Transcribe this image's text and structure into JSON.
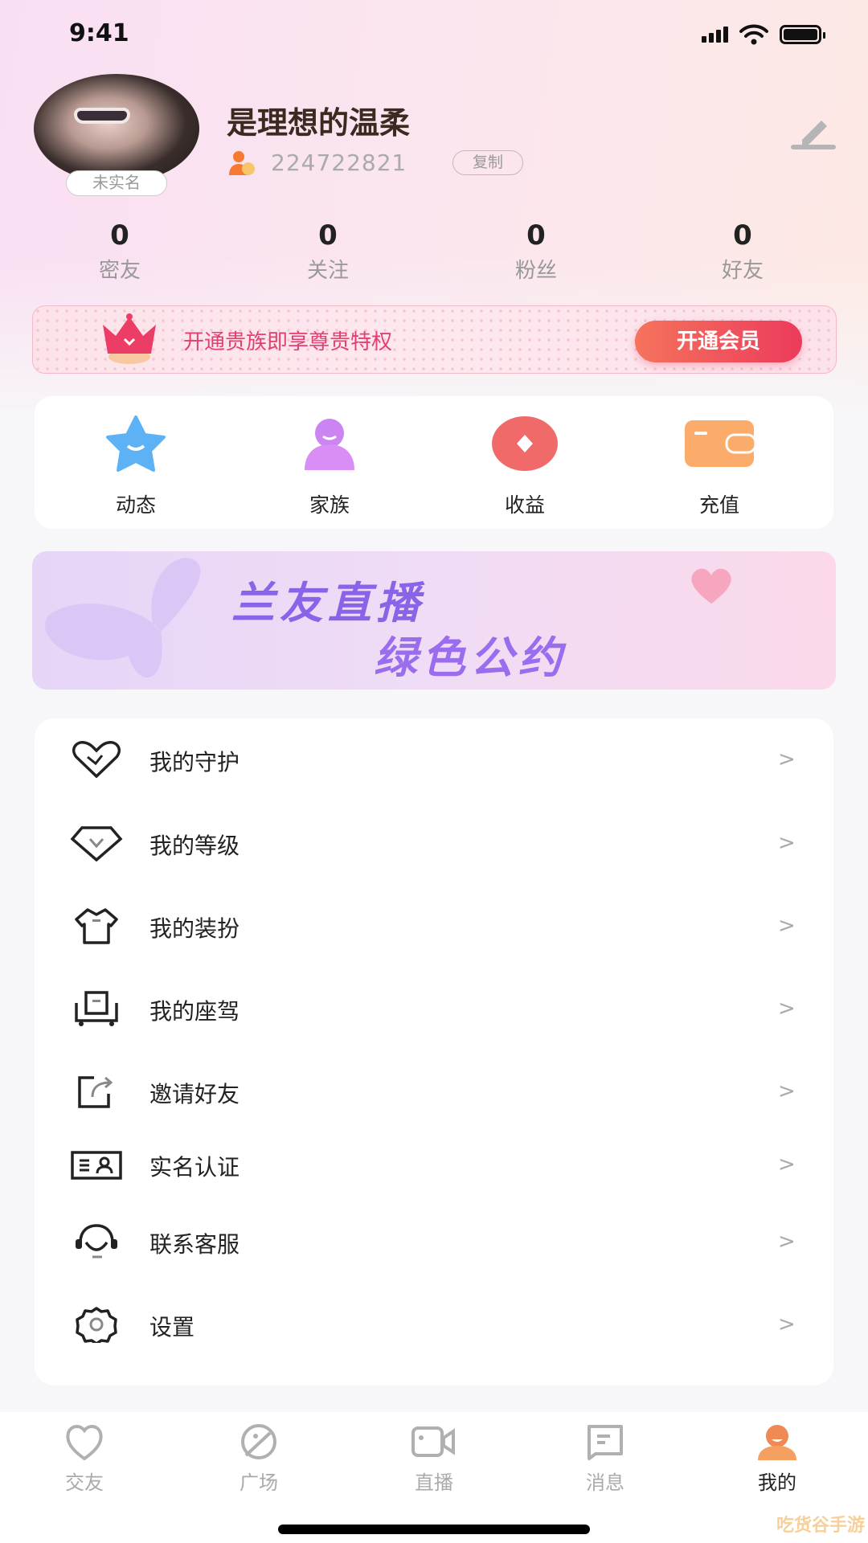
{
  "status_bar": {
    "time": "9:41"
  },
  "profile": {
    "name": "是理想的温柔",
    "user_id": "224722821",
    "copy_label": "复制",
    "verify_badge": "未实名"
  },
  "stats": [
    {
      "value": "0",
      "label": "密友"
    },
    {
      "value": "0",
      "label": "关注"
    },
    {
      "value": "0",
      "label": "粉丝"
    },
    {
      "value": "0",
      "label": "好友"
    }
  ],
  "vip_banner": {
    "text": "开通贵族即享尊贵特权",
    "button": "开通会员"
  },
  "quick_actions": [
    {
      "label": "动态",
      "icon": "star-icon"
    },
    {
      "label": "家族",
      "icon": "family-icon"
    },
    {
      "label": "收益",
      "icon": "coin-icon"
    },
    {
      "label": "充值",
      "icon": "wallet-icon"
    }
  ],
  "promo_banner": {
    "line1": "兰友直播",
    "line2": "绿色公约"
  },
  "menu": [
    {
      "label": "我的守护",
      "icon": "guard-heart-icon"
    },
    {
      "label": "我的等级",
      "icon": "diamond-icon"
    },
    {
      "label": "我的装扮",
      "icon": "shirt-icon"
    },
    {
      "label": "我的座驾",
      "icon": "car-icon"
    },
    {
      "label": "邀请好友",
      "icon": "share-icon"
    },
    {
      "label": "实名认证",
      "icon": "id-card-icon"
    },
    {
      "label": "联系客服",
      "icon": "headset-icon"
    },
    {
      "label": "设置",
      "icon": "gear-icon"
    }
  ],
  "chevron": ">",
  "tabs": [
    {
      "label": "交友",
      "icon": "heart-icon"
    },
    {
      "label": "广场",
      "icon": "planet-icon"
    },
    {
      "label": "直播",
      "icon": "video-camera-icon"
    },
    {
      "label": "消息",
      "icon": "message-icon"
    },
    {
      "label": "我的",
      "icon": "user-icon",
      "active": true
    }
  ],
  "colors": {
    "accent": "#f08a55",
    "vip": "#e2416f",
    "banner_text": "#8a63e8"
  },
  "watermark": "吃货谷手游"
}
